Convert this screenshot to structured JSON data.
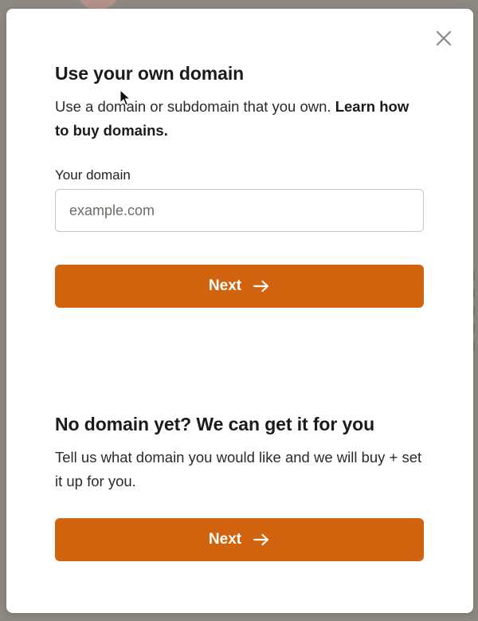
{
  "background": {
    "overlay_color": "#8d8882"
  },
  "modal": {
    "close_icon": "close-icon",
    "own_domain": {
      "title": "Use your own domain",
      "description": "Use a domain or subdomain that you own.",
      "learn_link": "Learn how to buy domains.",
      "field_label": "Your domain",
      "input_value": "",
      "input_placeholder": "example.com",
      "next_label": "Next",
      "next_icon": "arrow-right-icon"
    },
    "buy_domain": {
      "title": "No domain yet? We can get it for you",
      "description": "Tell us what domain you would like and we will buy + set it up for you.",
      "next_label": "Next",
      "next_icon": "arrow-right-icon"
    }
  },
  "colors": {
    "accent": "#d2630e",
    "text": "#1b1b1b",
    "input_border": "#c9c6c3"
  }
}
